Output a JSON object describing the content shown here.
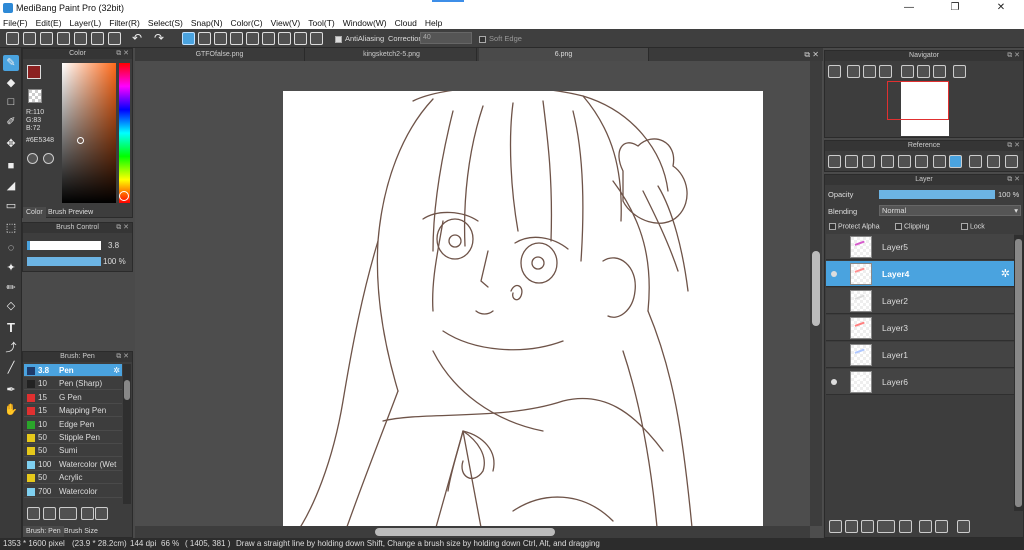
{
  "window": {
    "title": "MediBang Paint Pro (32bit)",
    "minimize": "—",
    "maximize": "❐",
    "close": "✕"
  },
  "menu": [
    "File(F)",
    "Edit(E)",
    "Layer(L)",
    "Filter(R)",
    "Select(S)",
    "Snap(N)",
    "Color(C)",
    "View(V)",
    "Tool(T)",
    "Window(W)",
    "Cloud",
    "Help"
  ],
  "toolbar": {
    "antialias_label": "AntiAliasing",
    "correction_label": "Correction",
    "correction_value": "40",
    "softedge_label": "Soft Edge"
  },
  "tabs": [
    "GTFOfalse.png",
    "kingsketch2-5.png",
    "6.png"
  ],
  "color_panel": {
    "title": "Color",
    "r": "R:110",
    "g": "G:83",
    "b": "B:72",
    "hex": "#6E5348",
    "tab_color": "Color",
    "tab_preview": "Brush Preview",
    "primary_color": "#8b2020"
  },
  "brush_control": {
    "title": "Brush Control",
    "size": "3.8",
    "opacity": "100 %"
  },
  "brush_panel": {
    "title": "Brush: Pen",
    "tab_pen": "Brush: Pen",
    "tab_size": "Brush Size",
    "items": [
      {
        "size": "3.8",
        "name": "Pen",
        "color": "#1f3b6b"
      },
      {
        "size": "10",
        "name": "Pen (Sharp)",
        "color": "#222222"
      },
      {
        "size": "15",
        "name": "G Pen",
        "color": "#e03030"
      },
      {
        "size": "15",
        "name": "Mapping Pen",
        "color": "#e03030"
      },
      {
        "size": "10",
        "name": "Edge Pen",
        "color": "#2aa52a"
      },
      {
        "size": "50",
        "name": "Stipple Pen",
        "color": "#e6c81a"
      },
      {
        "size": "50",
        "name": "Sumi",
        "color": "#e6c81a"
      },
      {
        "size": "100",
        "name": "Watercolor (Wet",
        "color": "#7fd0f0"
      },
      {
        "size": "50",
        "name": "Acrylic",
        "color": "#e6c81a"
      },
      {
        "size": "700",
        "name": "Watercolor",
        "color": "#7fd0f0"
      }
    ]
  },
  "navigator": {
    "title": "Navigator"
  },
  "reference": {
    "title": "Reference"
  },
  "layer_panel": {
    "title": "Layer",
    "opacity_label": "Opacity",
    "opacity_value": "100 %",
    "blending_label": "Blending",
    "blending_value": "Normal",
    "protect_alpha": "Protect Alpha",
    "clipping": "Clipping",
    "lock": "Lock",
    "layers": [
      {
        "name": "Layer5",
        "visible": false,
        "selected": false
      },
      {
        "name": "Layer4",
        "visible": true,
        "selected": true
      },
      {
        "name": "Layer2",
        "visible": false,
        "selected": false
      },
      {
        "name": "Layer3",
        "visible": false,
        "selected": false
      },
      {
        "name": "Layer1",
        "visible": false,
        "selected": false
      },
      {
        "name": "Layer6",
        "visible": true,
        "selected": false
      }
    ]
  },
  "status": {
    "size": "1353 * 1600 pixel",
    "cm": "(23.9 * 28.2cm)",
    "dpi": "144 dpi",
    "zoom": "66 %",
    "coords": "( 1405, 381 )",
    "hint": "Draw a straight line by holding down Shift, Change a brush size by holding down Ctrl, Alt, and dragging"
  }
}
